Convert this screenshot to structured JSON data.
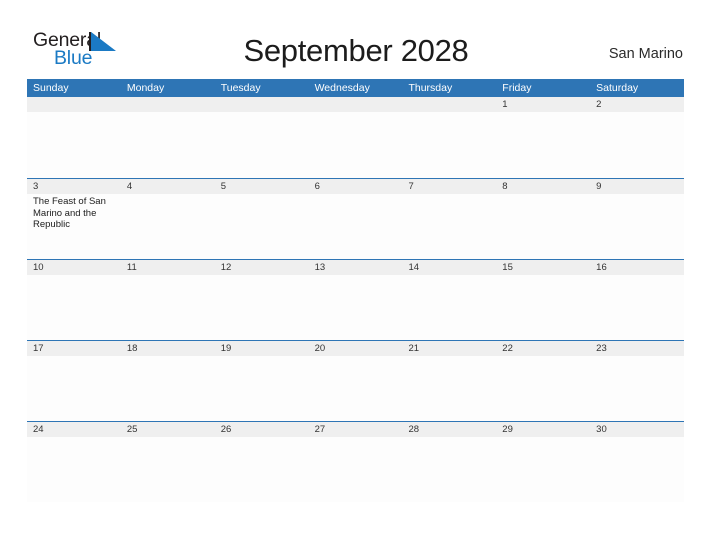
{
  "brand": {
    "name_part1": "General",
    "name_part2": "Blue",
    "flag_color": "#1b7ac4"
  },
  "header": {
    "title": "September 2028",
    "region": "San Marino",
    "header_bg_color": "#2e75b5",
    "date_band_color": "#efefef"
  },
  "calendar": {
    "weekdays": [
      "Sunday",
      "Monday",
      "Tuesday",
      "Wednesday",
      "Thursday",
      "Friday",
      "Saturday"
    ],
    "weeks": [
      [
        {
          "day": ""
        },
        {
          "day": ""
        },
        {
          "day": ""
        },
        {
          "day": ""
        },
        {
          "day": ""
        },
        {
          "day": "1"
        },
        {
          "day": "2"
        }
      ],
      [
        {
          "day": "3",
          "event": "The Feast of San Marino and the Republic"
        },
        {
          "day": "4"
        },
        {
          "day": "5"
        },
        {
          "day": "6"
        },
        {
          "day": "7"
        },
        {
          "day": "8"
        },
        {
          "day": "9"
        }
      ],
      [
        {
          "day": "10"
        },
        {
          "day": "11"
        },
        {
          "day": "12"
        },
        {
          "day": "13"
        },
        {
          "day": "14"
        },
        {
          "day": "15"
        },
        {
          "day": "16"
        }
      ],
      [
        {
          "day": "17"
        },
        {
          "day": "18"
        },
        {
          "day": "19"
        },
        {
          "day": "20"
        },
        {
          "day": "21"
        },
        {
          "day": "22"
        },
        {
          "day": "23"
        }
      ],
      [
        {
          "day": "24"
        },
        {
          "day": "25"
        },
        {
          "day": "26"
        },
        {
          "day": "27"
        },
        {
          "day": "28"
        },
        {
          "day": "29"
        },
        {
          "day": "30"
        }
      ]
    ]
  }
}
